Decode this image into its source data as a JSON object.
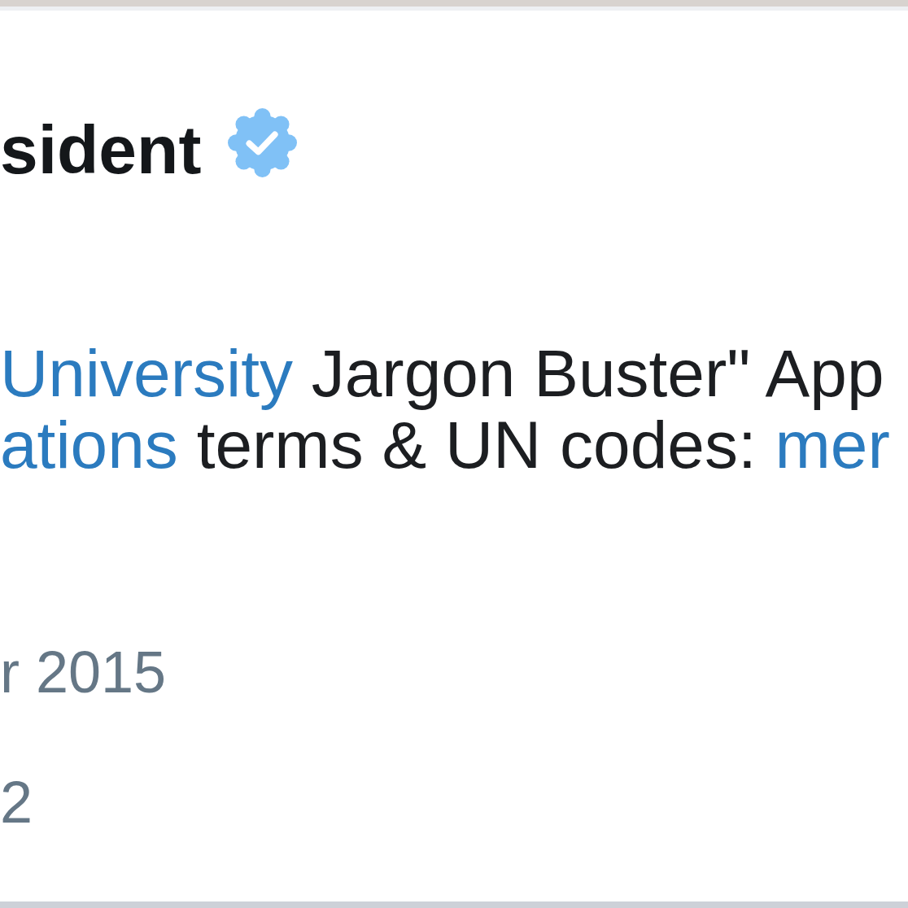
{
  "profile": {
    "display_name": "sident",
    "verified": true
  },
  "bio_lines": [
    [
      {
        "kind": "link",
        "text": "University"
      },
      {
        "kind": "text",
        "text": "Jargon Buster\" App"
      }
    ],
    [
      {
        "kind": "link",
        "text": "ations"
      },
      {
        "kind": "text",
        "text": "terms & UN codes:"
      },
      {
        "kind": "link",
        "text": "mer"
      }
    ]
  ],
  "meta_lines": [
    "r 2015",
    "2"
  ]
}
